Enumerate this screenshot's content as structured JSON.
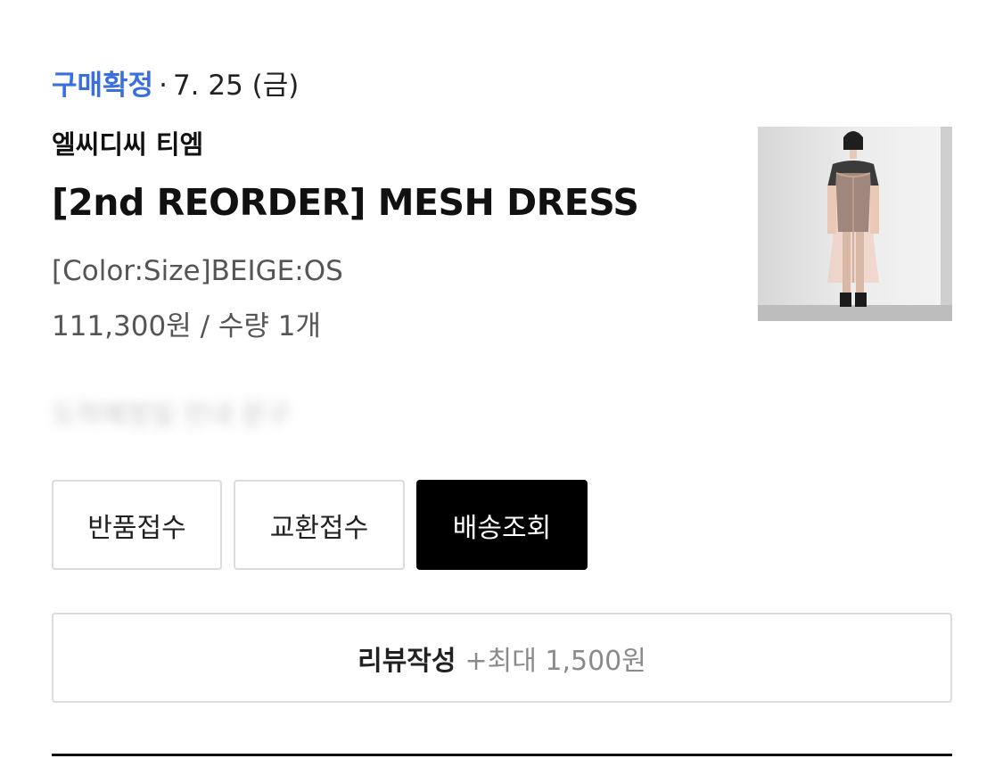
{
  "order": {
    "status": "구매확정",
    "separator": "·",
    "date": "7. 25 (금)"
  },
  "product": {
    "brand": "엘씨디씨 티엠",
    "name": "[2nd REORDER] MESH DRESS",
    "option": "[Color:Size]BEIGE:OS",
    "price_qty": "111,300원 / 수량 1개",
    "image_icon": "product-photo-dress"
  },
  "notice": "도착예정일 안내 문구",
  "actions": {
    "return": "반품접수",
    "exchange": "교환접수",
    "tracking": "배송조회"
  },
  "review": {
    "label": "리뷰작성",
    "reward": "+최대 1,500원"
  },
  "colors": {
    "status_accent": "#3b6fe0",
    "primary_button": "#000000",
    "muted_text": "#555555"
  }
}
